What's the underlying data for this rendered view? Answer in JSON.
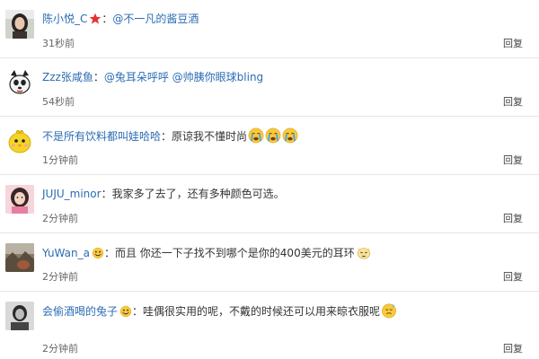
{
  "reply_label": "回复",
  "comments": [
    {
      "user": "陈小悦_C",
      "badge": "red-star",
      "separator": "：",
      "mention": "@不一凡的酱豆酒",
      "text": "",
      "time": "31秒前",
      "avatar": "girl-photo"
    },
    {
      "user": "Zzz张咸鱼",
      "badge": "",
      "separator": "：",
      "mention": "@兔耳朵呼呼 @帅胰你眼球bling",
      "text": "",
      "time": "54秒前",
      "avatar": "cartoon-dog"
    },
    {
      "user": "不是所有饮料都叫娃哈哈",
      "badge": "",
      "separator": "：",
      "mention": "",
      "text": "原谅我不懂时尚",
      "emoji": [
        "crying-face",
        "crying-face",
        "crying-face"
      ],
      "time": "1分钟前",
      "avatar": "yellow-chick"
    },
    {
      "user": "JUJU_minor",
      "badge": "",
      "separator": "：",
      "mention": "",
      "text": "我家多了去了，还有多种颜色可选。",
      "time": "2分钟前",
      "avatar": "pink-girl"
    },
    {
      "user": "YuWan_a",
      "badge": "smiley-badge",
      "separator": "：",
      "mention": "",
      "text": "而且 你还一下子找不到哪个是你的400美元的耳环",
      "emoji": [
        "cat-face"
      ],
      "time": "2分钟前",
      "avatar": "landscape-photo"
    },
    {
      "user": "会偷酒喝的兔子",
      "badge": "smiley-badge",
      "separator": "：",
      "mention": "",
      "text": "哇偶很实用的呢，不戴的时候还可以用来晾衣服呢",
      "emoji": [
        "sweat-face"
      ],
      "time": "2分钟前",
      "avatar": "bw-photo"
    }
  ]
}
